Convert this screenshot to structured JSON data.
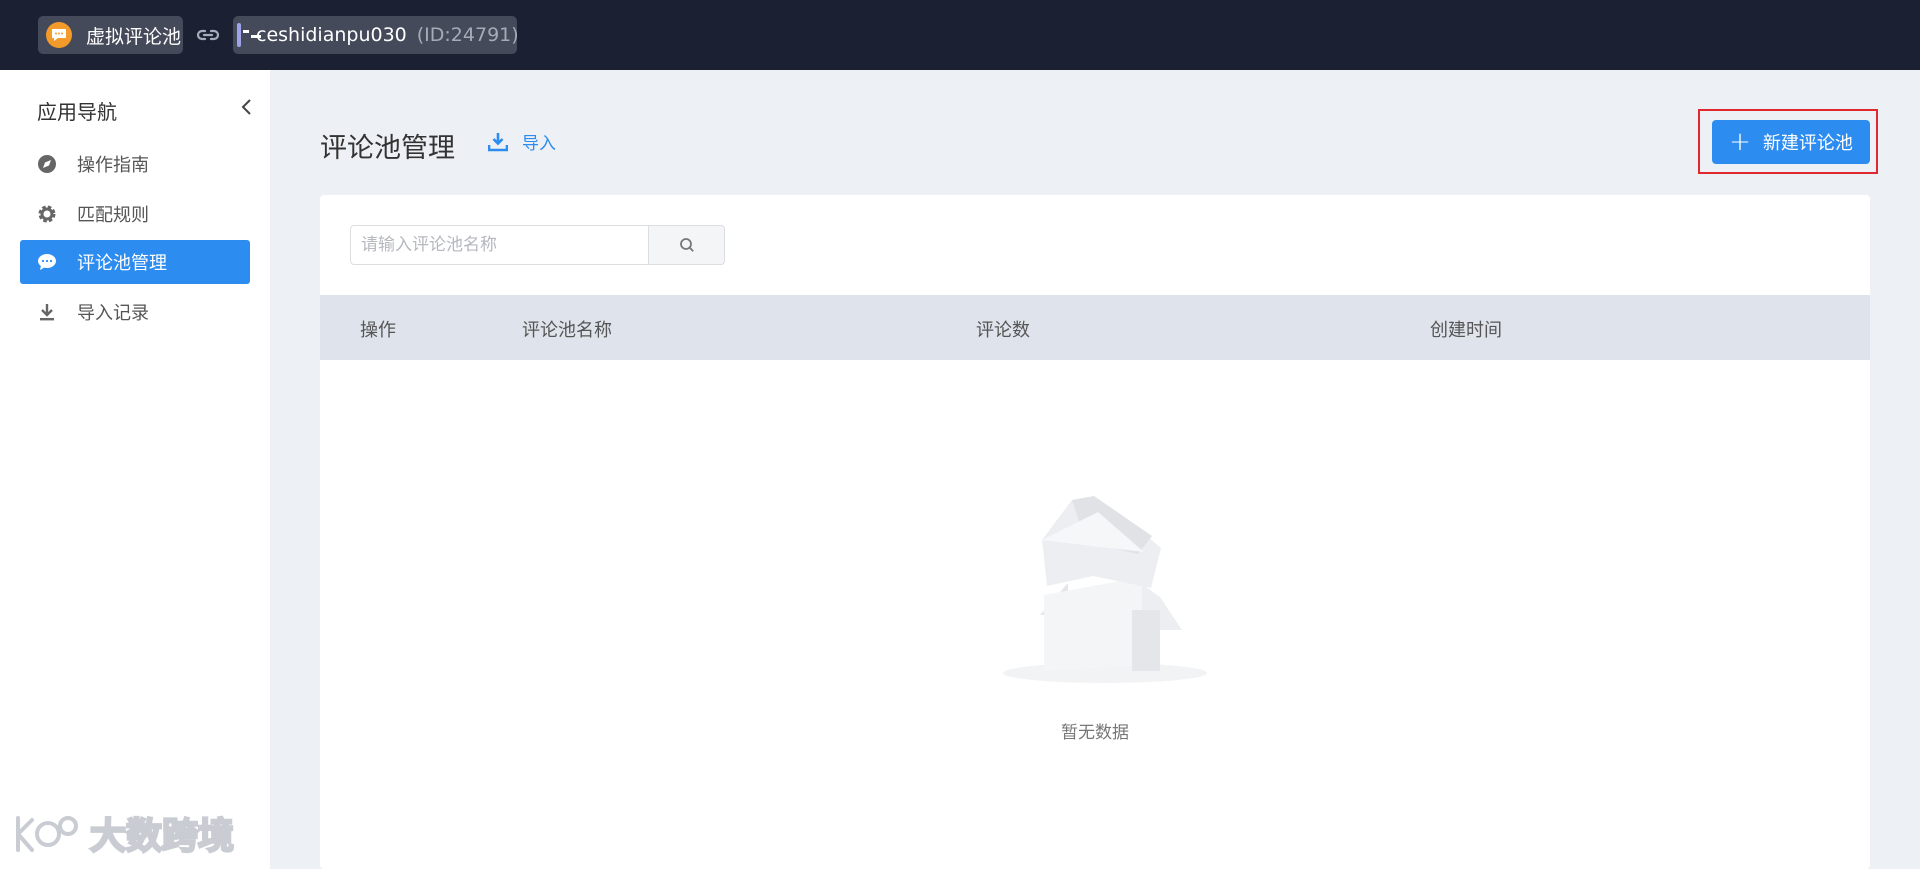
{
  "topbar": {
    "app_name": "虚拟评论池",
    "shop_name": "ceshidianpu030",
    "shop_id": "(ID:24791)"
  },
  "sidebar": {
    "title": "应用导航",
    "items": [
      {
        "label": "操作指南",
        "icon": "compass-icon",
        "active": false
      },
      {
        "label": "匹配规则",
        "icon": "gear-icon",
        "active": false
      },
      {
        "label": "评论池管理",
        "icon": "chat-bubble-icon",
        "active": true
      },
      {
        "label": "导入记录",
        "icon": "download-icon",
        "active": false
      }
    ],
    "watermark": "大数跨境"
  },
  "main": {
    "title": "评论池管理",
    "import_label": "导入",
    "new_button_label": "新建评论池",
    "search": {
      "placeholder": "请输入评论池名称",
      "value": ""
    },
    "table": {
      "columns": [
        "操作",
        "评论池名称",
        "评论数",
        "创建时间"
      ],
      "rows": []
    },
    "empty_text": "暂无数据"
  },
  "colors": {
    "topbar": "#1b2033",
    "accent": "#2d8cf0",
    "highlight": "#e0282e",
    "background": "#edf0f4"
  }
}
